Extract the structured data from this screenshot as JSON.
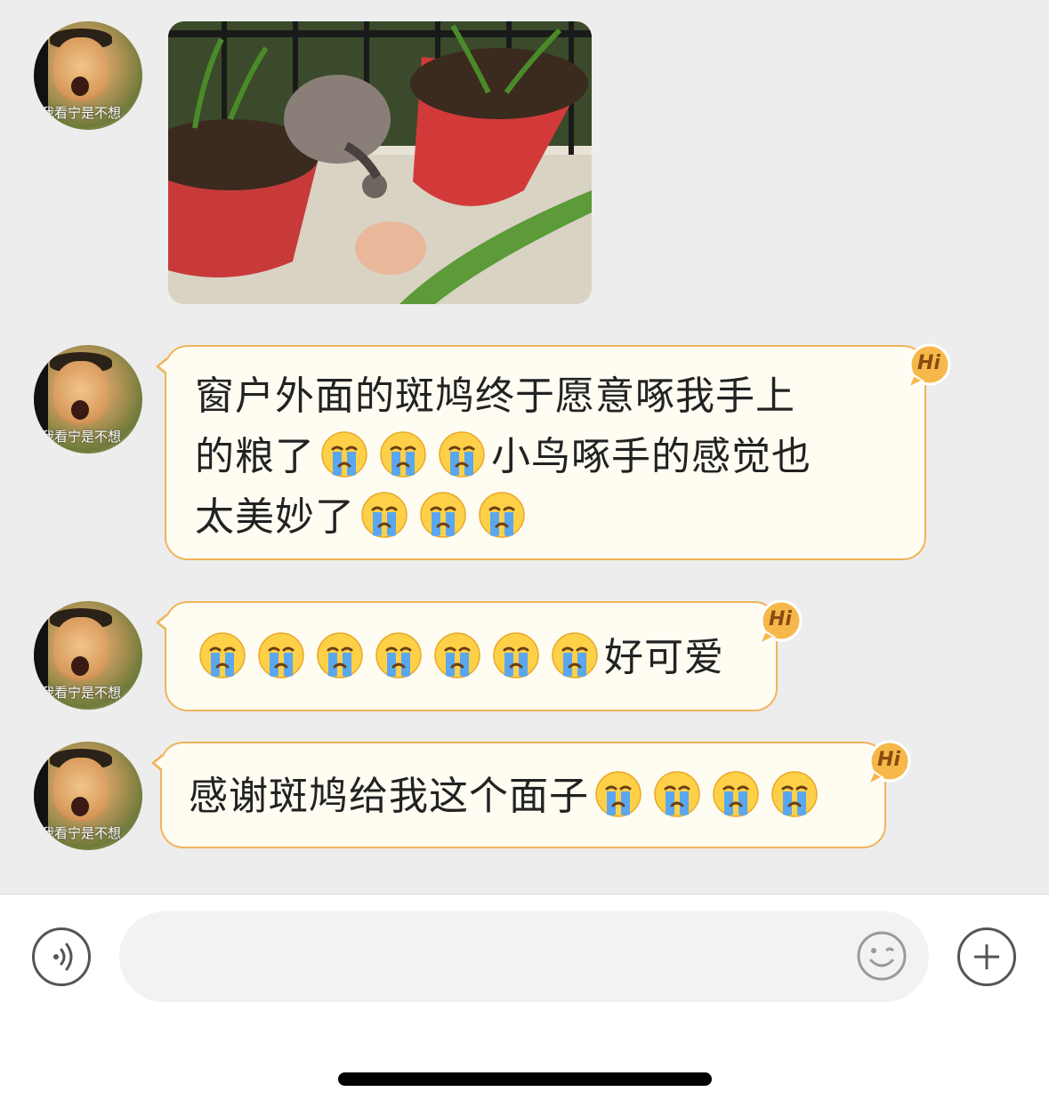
{
  "contact": {
    "avatar_caption": "我看宁是不想"
  },
  "messages": [
    {
      "type": "image",
      "image_name": "spotted-dove-eating-from-hand-photo"
    },
    {
      "type": "text",
      "lines": [
        "窗户外面的斑鸠终于愿意啄我手上",
        "的粮了",
        "小鸟啄手的感觉也",
        "太美妙了"
      ],
      "emoji": "loudly-crying-face"
    },
    {
      "type": "text",
      "text": "好可爱",
      "emoji": "loudly-crying-face"
    },
    {
      "type": "text",
      "text": "感谢斑鸠给我这个面子",
      "emoji": "loudly-crying-face"
    }
  ],
  "badge": {
    "label": "Hi"
  },
  "input": {
    "placeholder": "",
    "voice_icon": "voice-icon",
    "emoji_icon": "emoji-icon",
    "plus_icon": "plus-icon"
  },
  "colors": {
    "bubble_bg": "#fffcf2",
    "bubble_border": "#f0b35a",
    "chat_bg": "#ededed",
    "badge_bg": "#f7b84b"
  }
}
